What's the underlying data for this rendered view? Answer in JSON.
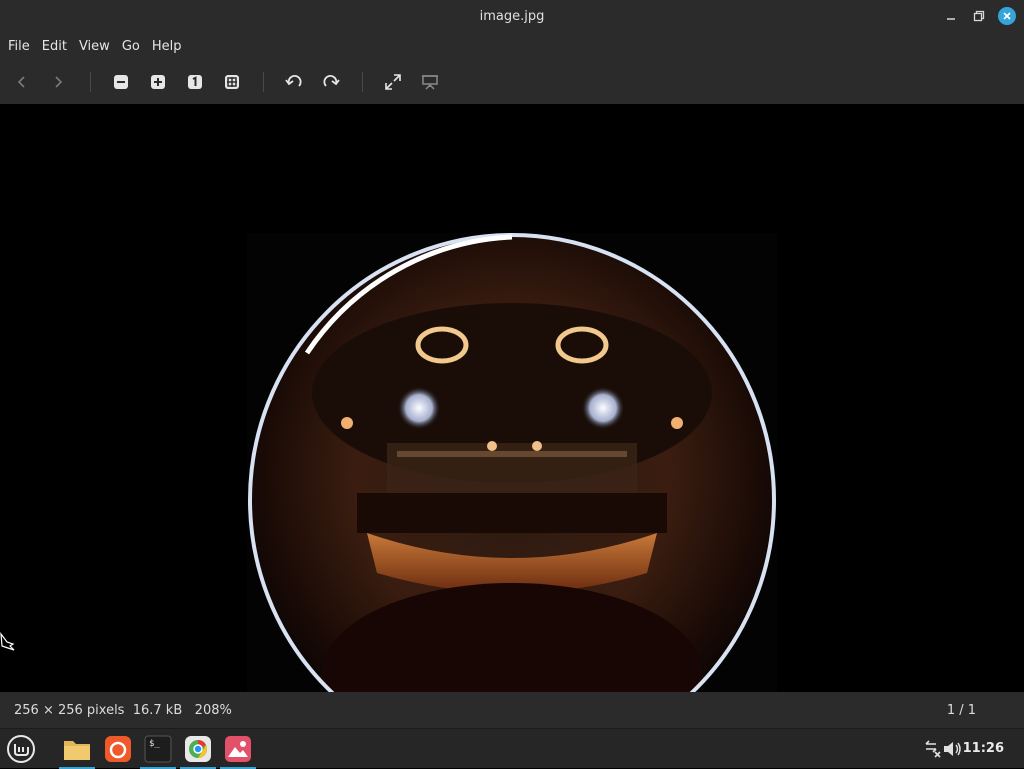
{
  "window": {
    "title": "image.jpg"
  },
  "menu": [
    "File",
    "Edit",
    "View",
    "Go",
    "Help"
  ],
  "toolbar": {
    "buttons": [
      "back-icon",
      "forward-icon",
      "zoom-out-icon",
      "zoom-in-icon",
      "zoom-normal-icon",
      "zoom-fit-icon",
      "rotate-left-icon",
      "rotate-right-icon",
      "fullscreen-icon",
      "slideshow-icon"
    ]
  },
  "status": {
    "dimensions": "256 × 256 pixels",
    "filesize": "16.7 kB",
    "zoom": "208%",
    "page": "1 / 1"
  },
  "taskbar": {
    "apps": [
      "menu-icon",
      "files-icon",
      "firefox-icon",
      "terminal-icon",
      "chrome-icon",
      "image-viewer-icon"
    ],
    "time": "11:26"
  },
  "colors": {
    "accent": "#35a4d8",
    "chrome": "#2b2b2b",
    "background": "#000000"
  }
}
